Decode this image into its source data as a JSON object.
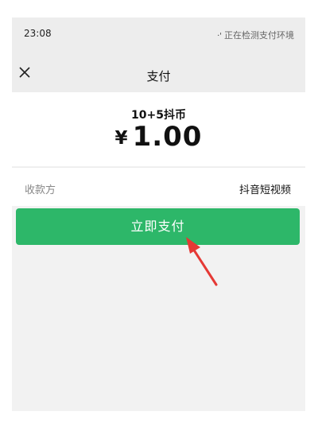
{
  "status_bar": {
    "time": "23:08",
    "detect_dots": "·'",
    "detect_text": "正在检测支付环境"
  },
  "header": {
    "title": "支付",
    "close_icon": "close-icon"
  },
  "order": {
    "product": "10+5抖币",
    "currency_symbol": "¥",
    "amount": "1.00"
  },
  "payee": {
    "label": "收款方",
    "name": "抖音短视频"
  },
  "actions": {
    "pay_label": "立即支付"
  },
  "colors": {
    "pay_button": "#2db769",
    "annotation_arrow": "#e53935",
    "header_bg": "#ededed"
  }
}
